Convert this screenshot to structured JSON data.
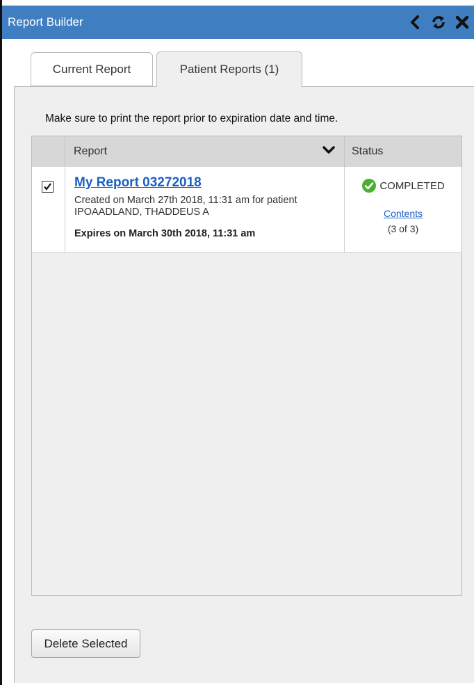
{
  "window": {
    "title": "Report Builder"
  },
  "titlebar_icons": [
    "back-chevron-icon",
    "refresh-icon",
    "close-icon"
  ],
  "tabs": [
    {
      "label": "Current Report",
      "active": false
    },
    {
      "label": "Patient Reports (1)",
      "active": true
    }
  ],
  "notice": "Make sure to print the report prior to expiration date and time.",
  "table": {
    "headers": {
      "report": "Report",
      "status": "Status"
    },
    "rows": [
      {
        "checked": true,
        "title": "My Report 03272018",
        "created": "Created on March 27th 2018, 11:31 am for patient IPOAADLAND, THADDEUS A",
        "expires": "Expires on March 30th 2018, 11:31 am",
        "status": "COMPLETED",
        "contents_link": "Contents",
        "count": "(3 of 3)"
      }
    ]
  },
  "actions": {
    "delete_selected": "Delete Selected"
  },
  "colors": {
    "titlebar": "#3f7fc1",
    "link": "#1a5fc4",
    "completed": "#4caf32"
  }
}
